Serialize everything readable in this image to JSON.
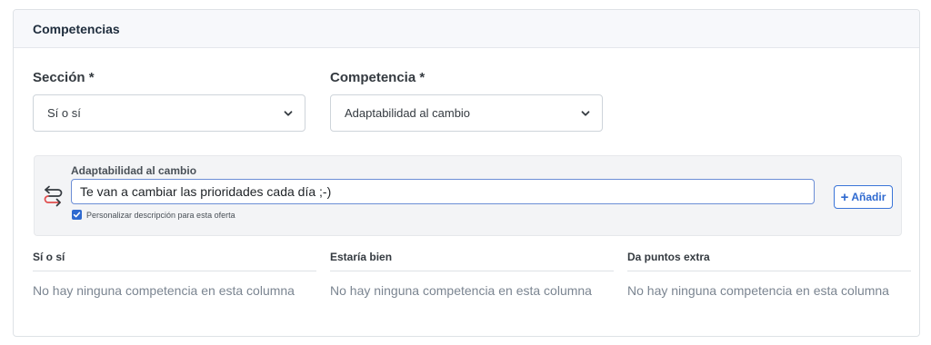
{
  "card": {
    "title": "Competencias"
  },
  "form": {
    "section_label": "Sección *",
    "section_value": "Sí o sí",
    "competence_label": "Competencia *",
    "competence_value": "Adaptabilidad al cambio"
  },
  "competence_item": {
    "title": "Adaptabilidad al cambio",
    "description_value": "Te van a cambiar las prioridades cada día ;-)",
    "customize_label": "Personalizar descripción para esta oferta",
    "customize_checked": true,
    "add_button_label": "Añadir"
  },
  "columns": [
    {
      "header": "Sí o sí",
      "empty_text": "No hay ninguna competencia en esta columna"
    },
    {
      "header": "Estaría bien",
      "empty_text": "No hay ninguna competencia en esta columna"
    },
    {
      "header": "Da puntos extra",
      "empty_text": "No hay ninguna competencia en esta columna"
    }
  ],
  "colors": {
    "accent": "#2f6ad0",
    "input_border_focus": "#6c8ed6",
    "panel_bg": "#f3f4f6"
  },
  "icons": [
    "chevron-down-icon",
    "swap-arrows-icon",
    "checkmark-icon",
    "plus-icon"
  ]
}
